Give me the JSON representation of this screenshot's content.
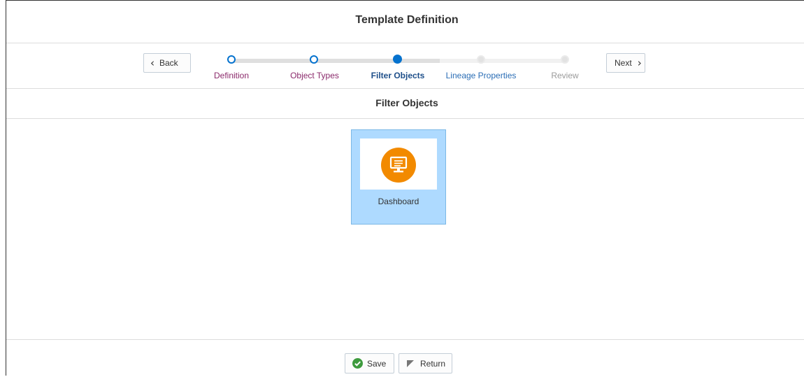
{
  "title": "Template Definition",
  "train": {
    "back_label": "Back",
    "next_label": "Next",
    "steps": [
      {
        "label": "Definition",
        "state": "visited"
      },
      {
        "label": "Object Types",
        "state": "visited"
      },
      {
        "label": "Filter Objects",
        "state": "current"
      },
      {
        "label": "Lineage Properties",
        "state": "unvisited"
      },
      {
        "label": "Review",
        "state": "disabled"
      }
    ]
  },
  "section": {
    "title": "Filter Objects"
  },
  "tiles": [
    {
      "label": "Dashboard",
      "icon": "monitor-icon",
      "selected": true,
      "icon_color": "#F28A00"
    }
  ],
  "footer": {
    "save_label": "Save",
    "return_label": "Return"
  },
  "colors": {
    "accent": "#0572CE",
    "selected_tile": "#AEDAFF",
    "visited_label": "#8B2A6B",
    "save_check": "#3E9B3E"
  }
}
